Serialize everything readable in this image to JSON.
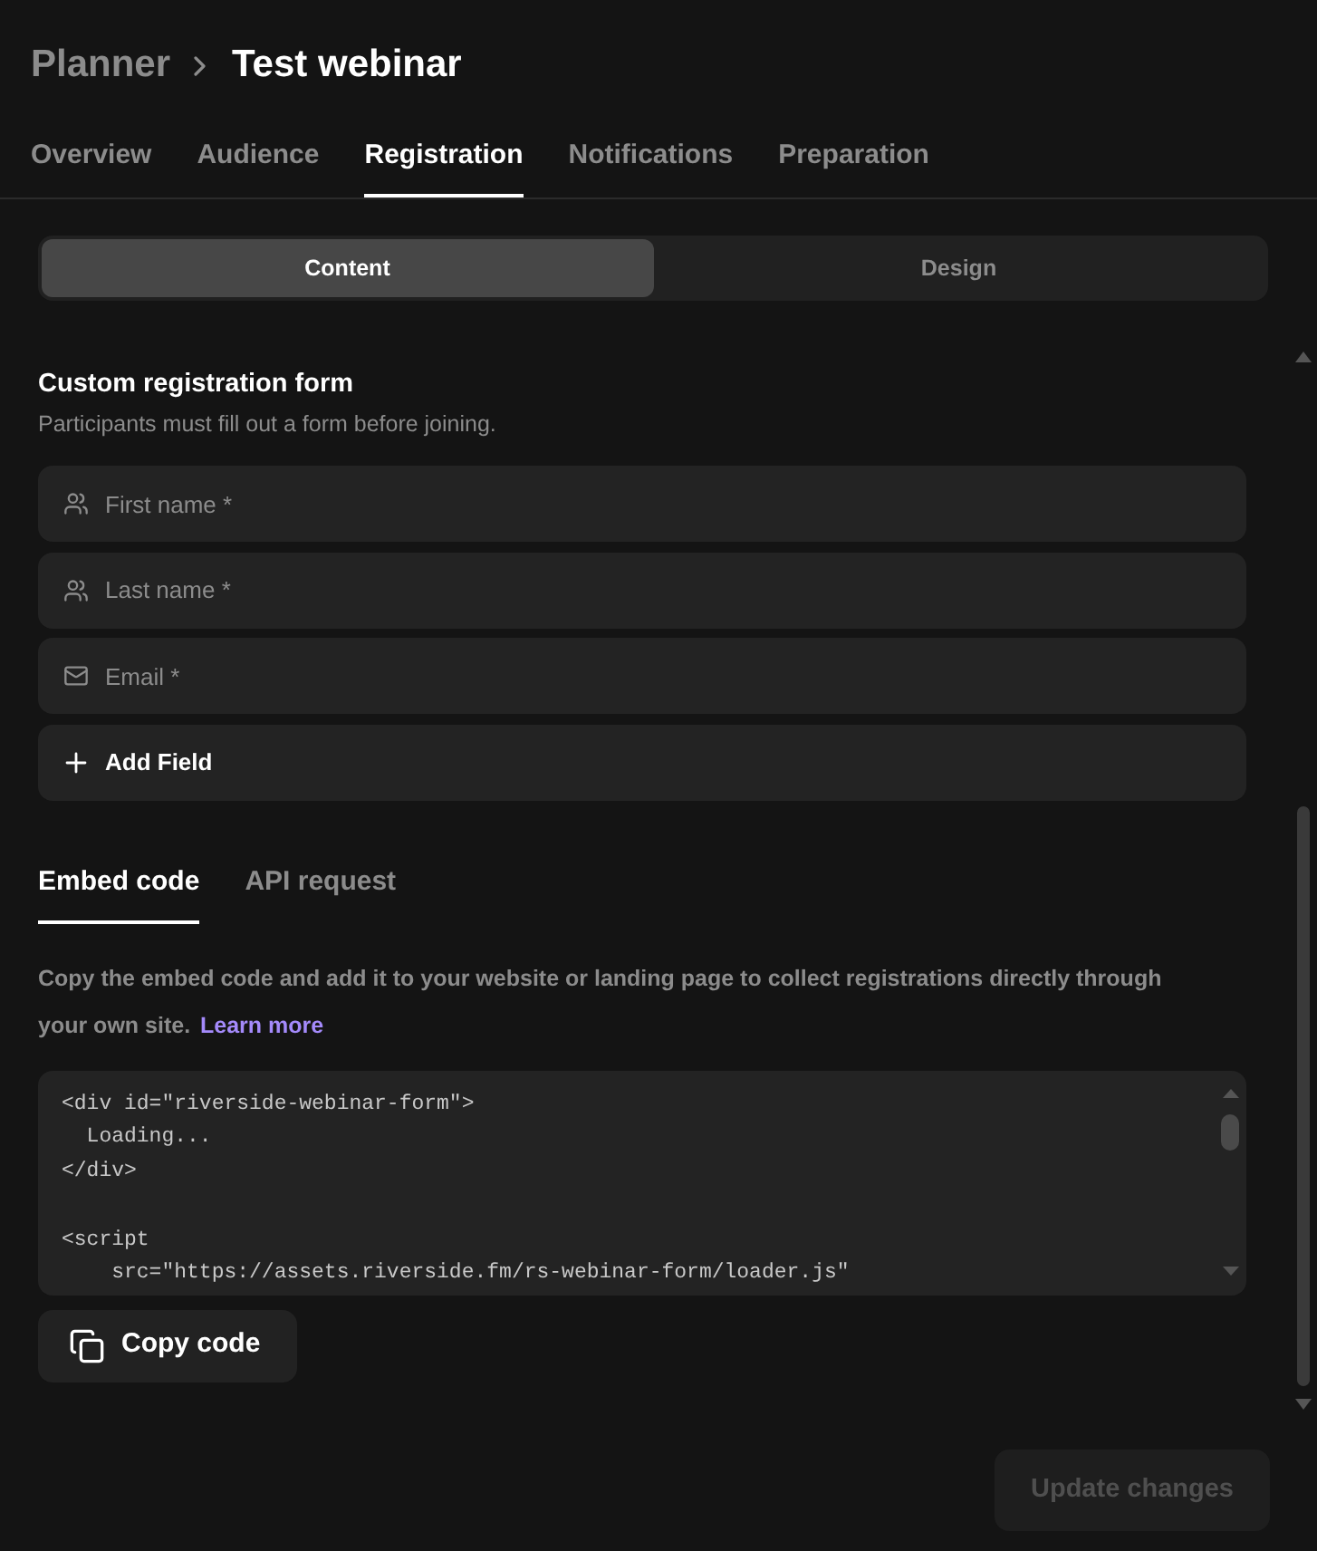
{
  "breadcrumb": {
    "parent": "Planner",
    "current": "Test webinar"
  },
  "tabs": [
    {
      "label": "Overview",
      "selected": false
    },
    {
      "label": "Audience",
      "selected": false
    },
    {
      "label": "Registration",
      "selected": true
    },
    {
      "label": "Notifications",
      "selected": false
    },
    {
      "label": "Preparation",
      "selected": false
    }
  ],
  "view_switch": [
    {
      "label": "Content",
      "selected": true
    },
    {
      "label": "Design",
      "selected": false
    }
  ],
  "registration_form": {
    "title": "Custom registration form",
    "description": "Participants must fill out a form before joining.",
    "fields": [
      {
        "kind": "name",
        "placeholder": "First name *"
      },
      {
        "kind": "name",
        "placeholder": "Last name *"
      },
      {
        "kind": "email",
        "placeholder": "Email *"
      }
    ],
    "add_button": "Add Field"
  },
  "embed_tabs": [
    {
      "label": "Embed code",
      "selected": true
    },
    {
      "label": "API request",
      "selected": false
    }
  ],
  "embed": {
    "description": "Copy the embed code and add it to your website or landing page to collect registrations directly through your own site.",
    "link": "Learn more",
    "code": "<div id=\"riverside-webinar-form\">\n  Loading...\n</div>\n\n<script\n    src=\"https://assets.riverside.fm/rs-webinar-form/loader.js\"",
    "copy_button": "Copy code"
  },
  "update_button": {
    "label": "Update changes",
    "disabled": true
  }
}
